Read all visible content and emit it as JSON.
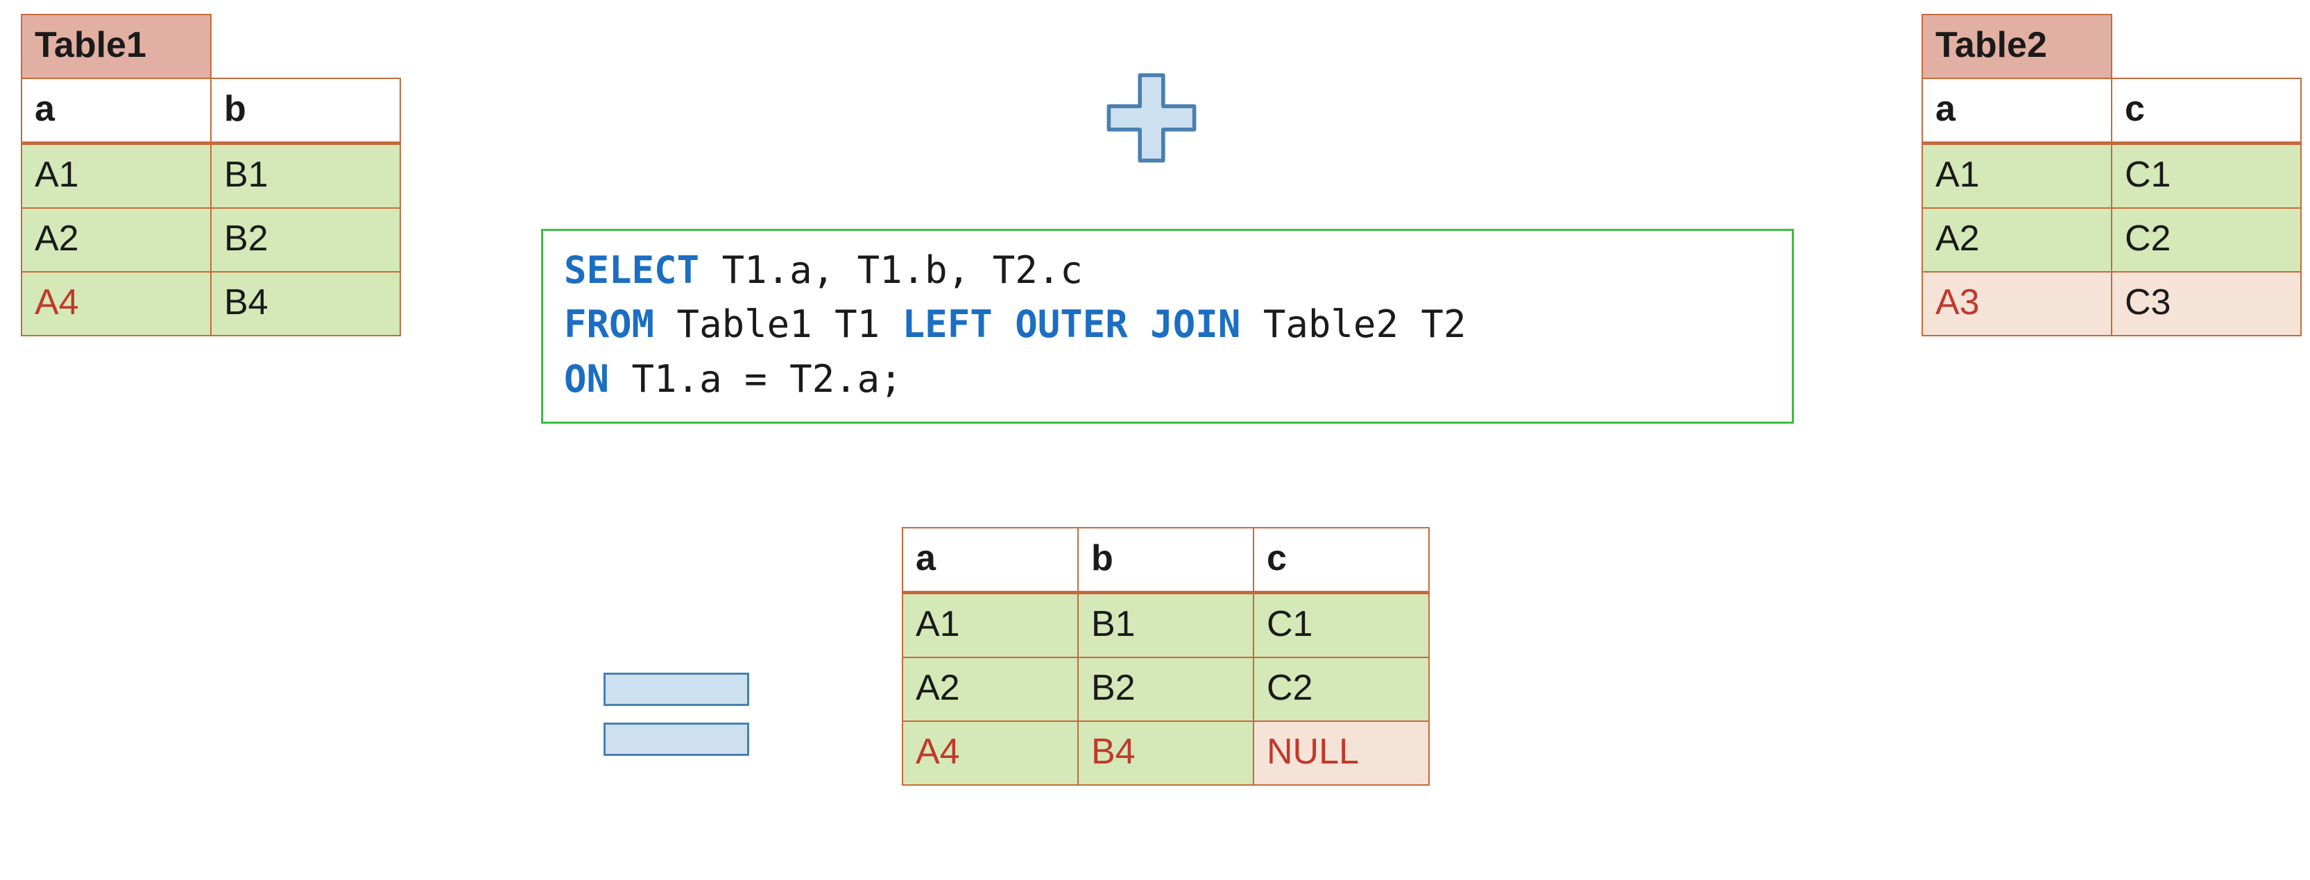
{
  "table1": {
    "title": "Table1",
    "columns": [
      "a",
      "b"
    ],
    "rows": [
      {
        "cells": [
          "A1",
          "B1"
        ],
        "bg": [
          "green",
          "green"
        ],
        "red": [
          false,
          false
        ]
      },
      {
        "cells": [
          "A2",
          "B2"
        ],
        "bg": [
          "green",
          "green"
        ],
        "red": [
          false,
          false
        ]
      },
      {
        "cells": [
          "A4",
          "B4"
        ],
        "bg": [
          "green",
          "green"
        ],
        "red": [
          true,
          false
        ]
      }
    ]
  },
  "table2": {
    "title": "Table2",
    "columns": [
      "a",
      "c"
    ],
    "rows": [
      {
        "cells": [
          "A1",
          "C1"
        ],
        "bg": [
          "green",
          "green"
        ],
        "red": [
          false,
          false
        ]
      },
      {
        "cells": [
          "A2",
          "C2"
        ],
        "bg": [
          "green",
          "green"
        ],
        "red": [
          false,
          false
        ]
      },
      {
        "cells": [
          "A3",
          "C3"
        ],
        "bg": [
          "pink",
          "pink"
        ],
        "red": [
          true,
          false
        ]
      }
    ]
  },
  "result": {
    "columns": [
      "a",
      "b",
      "c"
    ],
    "rows": [
      {
        "cells": [
          "A1",
          "B1",
          "C1"
        ],
        "bg": [
          "green",
          "green",
          "green"
        ],
        "red": [
          false,
          false,
          false
        ]
      },
      {
        "cells": [
          "A2",
          "B2",
          "C2"
        ],
        "bg": [
          "green",
          "green",
          "green"
        ],
        "red": [
          false,
          false,
          false
        ]
      },
      {
        "cells": [
          "A4",
          "B4",
          "NULL"
        ],
        "bg": [
          "green",
          "green",
          "pink"
        ],
        "red": [
          true,
          true,
          true
        ]
      }
    ]
  },
  "sql": {
    "line1_kw_select": "SELECT",
    "line1_rest": " T1.a, T1.b, T2.c",
    "line2_kw_from": "FROM",
    "line2_mid": " Table1 T1 ",
    "line2_kw_join": "LEFT OUTER JOIN",
    "line2_rest": " Table2 T2",
    "line3_kw_on": "ON",
    "line3_rest": " T1.a = T2.a;"
  },
  "colors": {
    "table_border": "#c66a3b",
    "title_bg": "#e2b0a3",
    "match_bg": "#d5e8b8",
    "nomatch_bg": "#f6e3d8",
    "keyword": "#1b6ec2",
    "sql_border": "#3bbf3b",
    "icon_fill": "#cde0ef",
    "icon_stroke": "#4a7fb0",
    "red_text": "#c0392b"
  }
}
